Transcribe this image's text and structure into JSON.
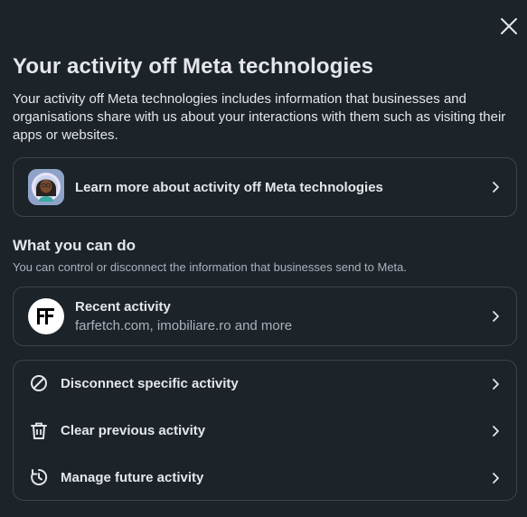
{
  "dialog": {
    "title": "Your activity off Meta technologies",
    "description": "Your activity off Meta technologies includes information that businesses and organisations share with us about your interactions with them such as visiting their apps or websites."
  },
  "learn_more": {
    "label": "Learn more about activity off Meta technologies",
    "avatar_icon": "woman-avatar-icon"
  },
  "what_you_can_do": {
    "title": "What you can do",
    "subtitle": "You can control or disconnect the information that businesses send to Meta."
  },
  "recent_activity": {
    "label": "Recent activity",
    "sublabel": "farfetch.com, imobiliare.ro and more",
    "logo_icon": "farfetch-logo-icon"
  },
  "actions": [
    {
      "label": "Disconnect specific activity",
      "icon": "disconnect-icon"
    },
    {
      "label": "Clear previous activity",
      "icon": "trash-icon"
    },
    {
      "label": "Manage future activity",
      "icon": "clock-manage-icon"
    }
  ],
  "colors": {
    "background": "#1c2329",
    "border": "#3a454e",
    "primary_text": "#e4e6eb",
    "secondary_text": "#a8b3bd"
  }
}
